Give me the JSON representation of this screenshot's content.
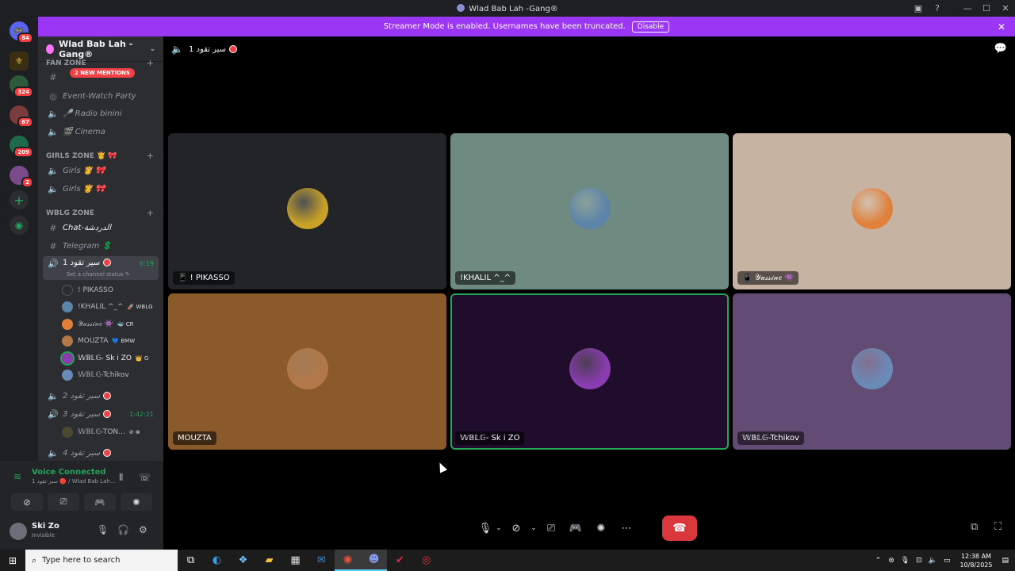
{
  "window": {
    "title": "Wlad Bab Lah -Gang®"
  },
  "banner": {
    "text": "Streamer Mode is enabled. Usernames have been truncated.",
    "disable_label": "Disable"
  },
  "servers": {
    "badges": [
      "84",
      "324",
      "67",
      "209",
      "2"
    ]
  },
  "sidebar": {
    "guild_name": "Wlad Bab Lah -Gang®",
    "mentions_badge": "2 NEW MENTIONS",
    "categories": {
      "fan_zone": "FAN ZONE",
      "girls_zone": "GIRLS ZONE 👸 🎀",
      "wblg_zone": "WBLG ZONE"
    },
    "channels": {
      "event_watch_party": "Event-Watch Party",
      "radio_binini": "🎤 Radio binini",
      "cinema": "🎬 Cinema",
      "girls_1": "Girls 👸 🎀",
      "girls_2": "Girls 👸 🎀",
      "chat": "Chat-الدردشة",
      "telegram": "Telegram 💲",
      "voice_1": "سير تقود 1",
      "voice_1_status": "Set a channel status ✎",
      "voice_1_timer": "6:19",
      "voice_2": "سير تقود 2",
      "voice_3": "سير تقود 3",
      "voice_3_timer": "1:42:21",
      "voice_3_user": "𝕎𝔹𝕃𝔾-TON...",
      "voice_4": "سير تقود 4"
    },
    "voice_users": [
      {
        "name": "! PIKASSO",
        "tag": ""
      },
      {
        "name": "!KHALIL ^_^",
        "tag": "🚀 WBLG"
      },
      {
        "name": "𝒴𝒶𝓈𝓈𝒾𝓃𝑒 👾",
        "tag": "🐳 CR"
      },
      {
        "name": "MOUZTA",
        "tag": "💙 BMW"
      },
      {
        "name": "𝕎𝔹𝕃𝔾- Sk i ZO",
        "tag": "👑 G"
      },
      {
        "name": "𝕎𝔹𝕃𝔾-Tchikov",
        "tag": ""
      }
    ]
  },
  "voice_panel": {
    "status": "Voice Connected",
    "channel": "سير تقود 1 🔴 / Wlad Bab Lah...",
    "user_name": "Ski Zo",
    "user_status": "Invisible"
  },
  "stage": {
    "channel_name": "سير تقود 1",
    "tiles": [
      {
        "name": "📱 ! PIKASSO",
        "bg": "#232428",
        "avatar": "#c9a227"
      },
      {
        "name": "!KHALIL ^_^",
        "bg": "#6f8a80",
        "avatar": "#5c83a8"
      },
      {
        "name": "📱 𝒴𝒶𝓈𝓈𝒾𝓃𝑒 👾",
        "bg": "#c6b3a2",
        "avatar": "#e0803a"
      },
      {
        "name": "MOUZTA",
        "bg": "#8a5a2a",
        "avatar": "#b37848"
      },
      {
        "name": "𝕎𝔹𝕃𝔾- Sk i ZO",
        "bg": "#200d2c",
        "avatar": "#8a3cb0"
      },
      {
        "name": "𝕎𝔹𝕃𝔾-Tchikov",
        "bg": "#634c73",
        "avatar": "#6a8ab8"
      }
    ]
  },
  "taskbar": {
    "search_placeholder": "Type here to search",
    "time": "12:38 AM",
    "date": "10/8/2025"
  }
}
